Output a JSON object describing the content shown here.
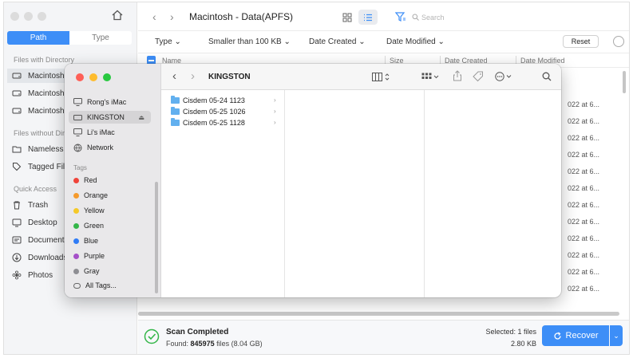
{
  "sidebar": {
    "tabs": [
      {
        "label": "Path",
        "active": true
      },
      {
        "label": "Type",
        "active": false
      }
    ],
    "sections": {
      "files_with_directory": "Files with Directory",
      "files_without_directory": "Files without Dire",
      "quick_access": "Quick Access"
    },
    "drives": [
      "Macintosh -",
      "Macintosh -",
      "Macintosh -"
    ],
    "no_dir_items": [
      "Nameless F",
      "Tagged File"
    ],
    "quick_items": [
      "Trash",
      "Desktop",
      "Documents",
      "Downloads",
      "Photos"
    ]
  },
  "toolbar": {
    "path_title": "Macintosh - Data(APFS)",
    "search_placeholder": "Search"
  },
  "filters": {
    "type": "Type",
    "size": "Smaller than 100 KB",
    "date_created": "Date Created",
    "date_modified": "Date Modified",
    "reset": "Reset"
  },
  "columns": {
    "name": "Name",
    "size": "Size",
    "date_created": "Date Created",
    "date_modified": "Date Modified"
  },
  "row_tails": [
    "022 at 6...",
    "022 at 6...",
    "022 at 6...",
    "022 at 6...",
    "022 at 6...",
    "022 at 6...",
    "022 at 6...",
    "022 at 6...",
    "022 at 6...",
    "022 at 6...",
    "022 at 6...",
    "022 at 6..."
  ],
  "status": {
    "title": "Scan Completed",
    "found_label": "Found:",
    "found_count": "845975",
    "found_suffix": "files (8.04 GB)",
    "selected": "Selected: 1 files",
    "selected_size": "2.80 KB",
    "recover": "Recover"
  },
  "finder": {
    "title": "KINGSTON",
    "locations": [
      "Rong's iMac",
      "KINGSTON",
      "Li's iMac",
      "Network"
    ],
    "tags_title": "Tags",
    "tags": [
      {
        "label": "Red",
        "color": "#f0443a"
      },
      {
        "label": "Orange",
        "color": "#f59a2c"
      },
      {
        "label": "Yellow",
        "color": "#f5c928"
      },
      {
        "label": "Green",
        "color": "#34b649"
      },
      {
        "label": "Blue",
        "color": "#2f7cf6"
      },
      {
        "label": "Purple",
        "color": "#a550c8"
      },
      {
        "label": "Gray",
        "color": "#8e8e93"
      }
    ],
    "all_tags": "All Tags...",
    "folders": [
      "Cisdem 05-24 1123",
      "Cisdem 05-25 1026",
      "Cisdem 05-25 1128"
    ]
  },
  "colors": {
    "accent": "#3d8ef7",
    "success": "#34b649"
  }
}
